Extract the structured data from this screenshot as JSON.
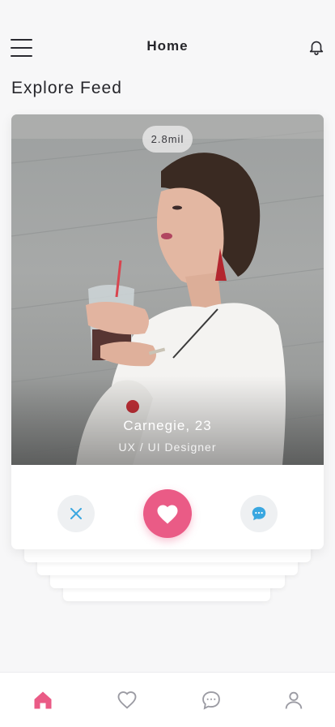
{
  "header": {
    "title": "Home",
    "menu_icon": "hamburger-menu-icon",
    "notification_icon": "bell-icon"
  },
  "feed": {
    "title": "Explore Feed"
  },
  "card": {
    "views": "2.8mil",
    "name": "Carnegie, 23",
    "role": "UX / UI Designer",
    "actions": {
      "dismiss_icon": "close-icon",
      "like_icon": "heart-icon",
      "message_icon": "chat-bubble-icon"
    }
  },
  "bottom_nav": {
    "items": [
      {
        "icon": "home-icon",
        "active": true
      },
      {
        "icon": "heart-outline-icon",
        "active": false
      },
      {
        "icon": "chat-outline-icon",
        "active": false
      },
      {
        "icon": "profile-icon",
        "active": false
      }
    ]
  },
  "colors": {
    "accent": "#ea5b86",
    "icon_blue": "#3aa7e0",
    "background": "#f7f7f8",
    "text": "#26262b"
  }
}
